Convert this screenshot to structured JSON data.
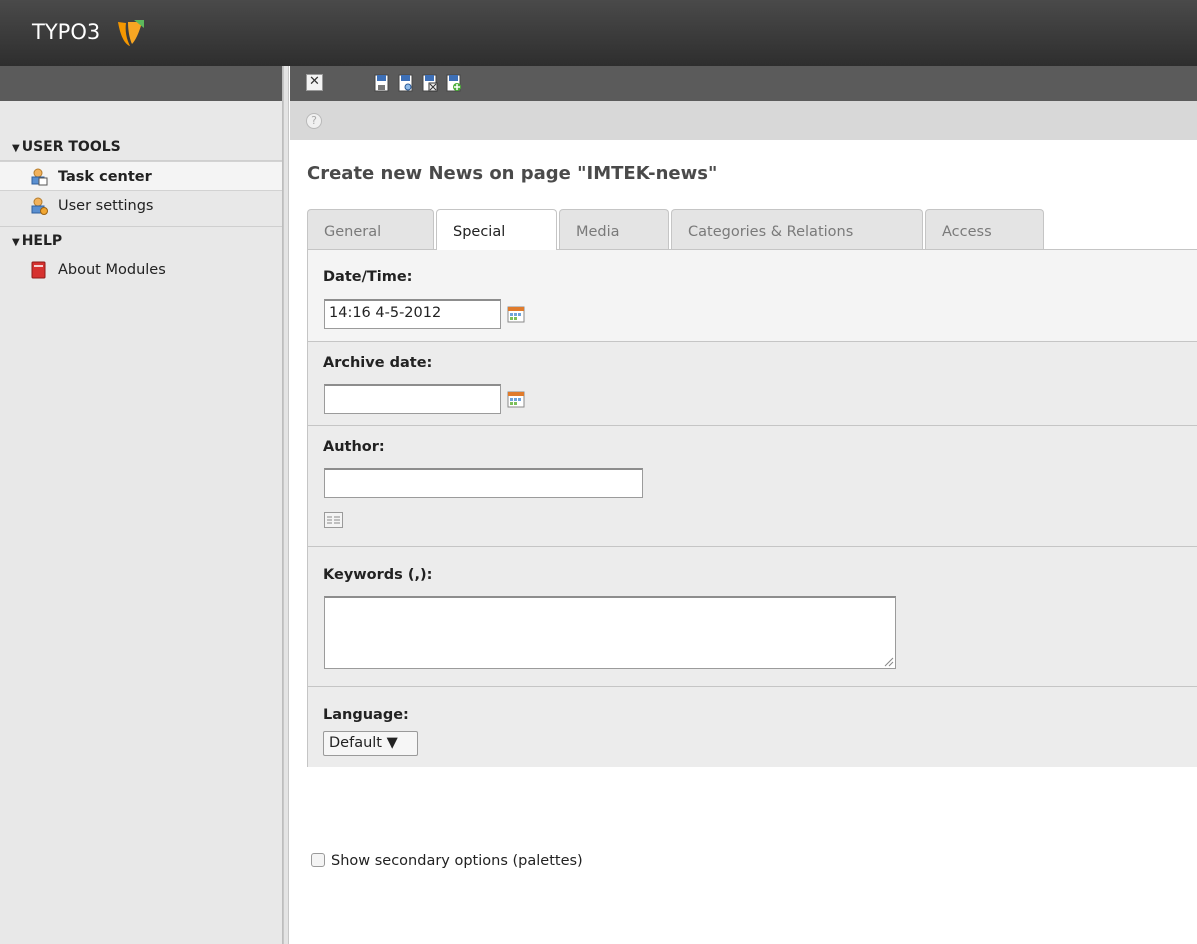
{
  "app": {
    "logo_text": "TYPO3"
  },
  "sidebar": {
    "sections": [
      {
        "title": "USER TOOLS",
        "items": [
          {
            "label": "Task center",
            "active": true
          },
          {
            "label": "User settings",
            "active": false
          }
        ]
      },
      {
        "title": "HELP",
        "items": [
          {
            "label": "About Modules",
            "active": false
          }
        ]
      }
    ]
  },
  "docbar": {
    "close_symbol": "✕",
    "buttons": [
      "save-icon",
      "save-and-view-icon",
      "save-and-close-icon",
      "save-and-new-icon"
    ]
  },
  "help_symbol": "?",
  "page": {
    "title": "Create new News on page \"IMTEK-news\"",
    "tabs": [
      "General",
      "Special",
      "Media",
      "Categories & Relations",
      "Access"
    ],
    "active_tab": "Special"
  },
  "fields": {
    "datetime": {
      "label": "Date/Time:",
      "value": "14:16 4-5-2012"
    },
    "archive": {
      "label": "Archive date:",
      "value": ""
    },
    "author": {
      "label": "Author:",
      "value": ""
    },
    "keywords": {
      "label": "Keywords (,):",
      "value": ""
    },
    "language": {
      "label": "Language:",
      "value": "Default ▼"
    }
  },
  "secondary_options": {
    "label": "Show secondary options (palettes)",
    "checked": false
  },
  "colors": {
    "topbar": "#3a3a3a",
    "docbar": "#5b5b5b",
    "logo_orange": "#f49700",
    "logo_green": "#5cb85c"
  }
}
